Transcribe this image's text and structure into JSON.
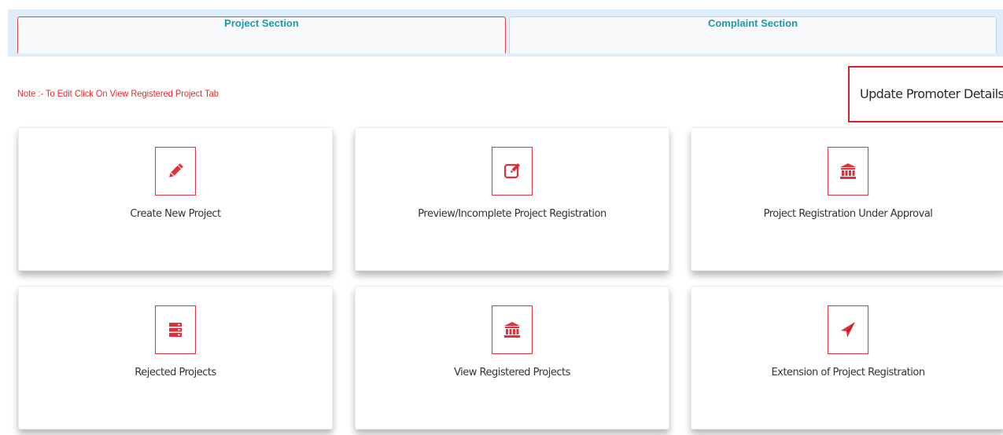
{
  "tabs": [
    {
      "label": "Project Section",
      "active": true
    },
    {
      "label": "Complaint Section",
      "active": false
    }
  ],
  "note": "Note :- To Edit Click On View Registered Project Tab",
  "update_button": "Update Promoter Details",
  "cards": [
    {
      "label": "Create New Project",
      "icon": "pencil-icon"
    },
    {
      "label": "Preview/Incomplete Project Registration",
      "icon": "edit-square-icon"
    },
    {
      "label": "Project Registration Under Approval",
      "icon": "institution-icon"
    },
    {
      "label": "Rejected Projects",
      "icon": "server-list-icon"
    },
    {
      "label": "View Registered Projects",
      "icon": "institution-icon"
    },
    {
      "label": "Extension of Project Registration",
      "icon": "paper-plane-icon"
    }
  ],
  "colors": {
    "accent": "#e0313a",
    "tab_text": "#1a9ab0",
    "note_text": "#e8272c",
    "tab_bar": "#dfeef8"
  }
}
